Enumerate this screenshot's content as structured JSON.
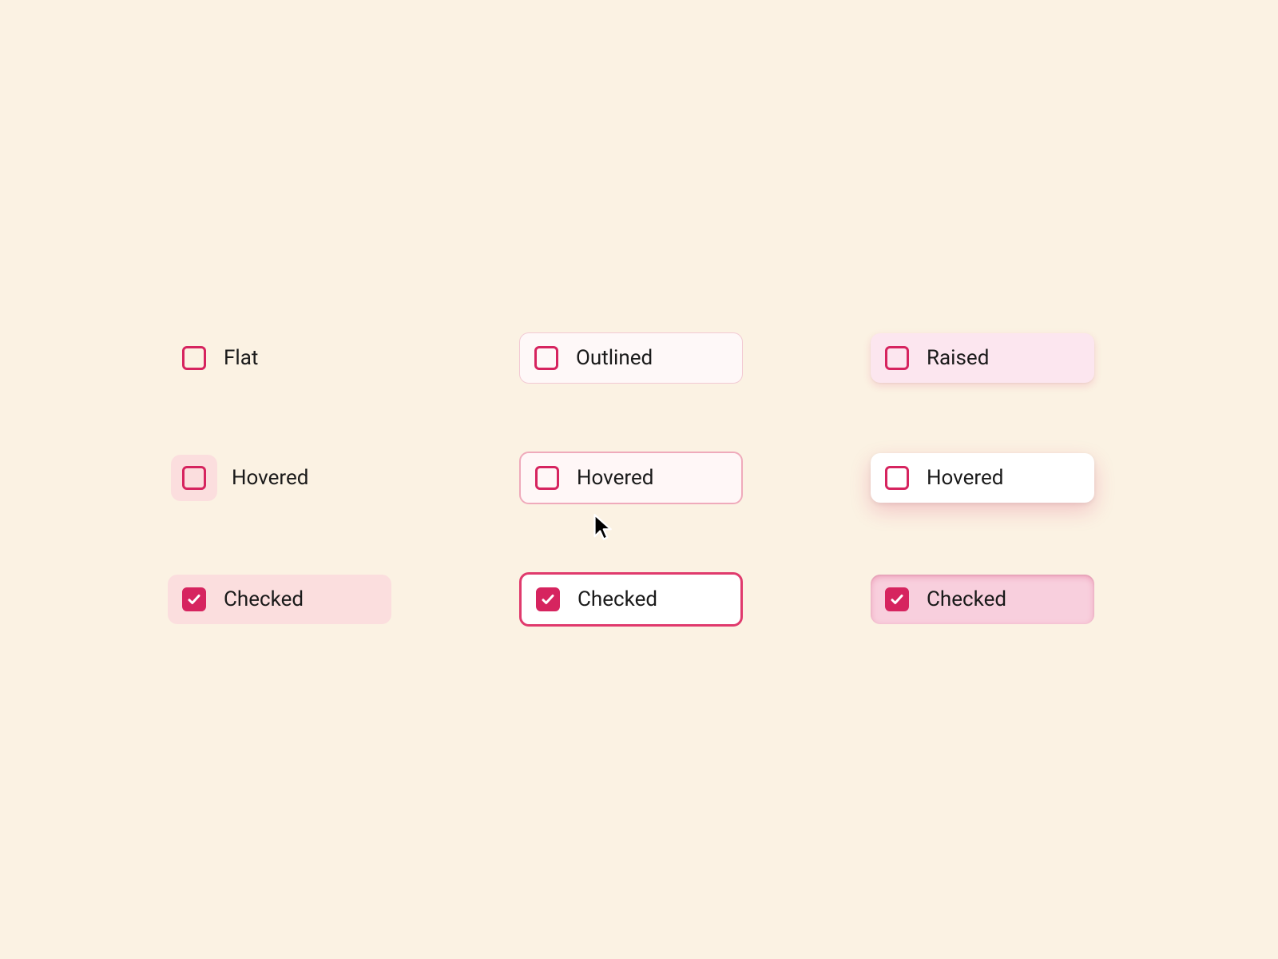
{
  "variant_labels": {
    "flat": "Flat",
    "outlined": "Outlined",
    "raised": "Raised"
  },
  "state_labels": {
    "hovered": "Hovered",
    "checked": "Checked"
  },
  "colors": {
    "background": "#fbf2e3",
    "accent": "#d6245f",
    "tint_light": "#fbdede",
    "tint_medium": "#fce6ef",
    "tint_dark": "#f8cfdd",
    "outline_light": "#f2c9d3",
    "outline_medium": "#efaabb",
    "outline_dark": "#e03a6d",
    "text": "#1a1a1a"
  },
  "icons": {
    "checkbox_unchecked": "checkbox-unchecked-icon",
    "checkbox_checked": "checkbox-checked-icon",
    "cursor": "cursor-icon"
  },
  "grid": [
    {
      "variant": "flat",
      "state": "default",
      "checked": false,
      "label_key": "variant_labels.flat"
    },
    {
      "variant": "outlined",
      "state": "default",
      "checked": false,
      "label_key": "variant_labels.outlined"
    },
    {
      "variant": "raised",
      "state": "default",
      "checked": false,
      "label_key": "variant_labels.raised"
    },
    {
      "variant": "flat",
      "state": "hovered",
      "checked": false,
      "label_key": "state_labels.hovered"
    },
    {
      "variant": "outlined",
      "state": "hovered",
      "checked": false,
      "label_key": "state_labels.hovered"
    },
    {
      "variant": "raised",
      "state": "hovered",
      "checked": false,
      "label_key": "state_labels.hovered"
    },
    {
      "variant": "flat",
      "state": "checked",
      "checked": true,
      "label_key": "state_labels.checked"
    },
    {
      "variant": "outlined",
      "state": "checked",
      "checked": true,
      "label_key": "state_labels.checked"
    },
    {
      "variant": "raised",
      "state": "checked",
      "checked": true,
      "label_key": "state_labels.checked"
    }
  ]
}
